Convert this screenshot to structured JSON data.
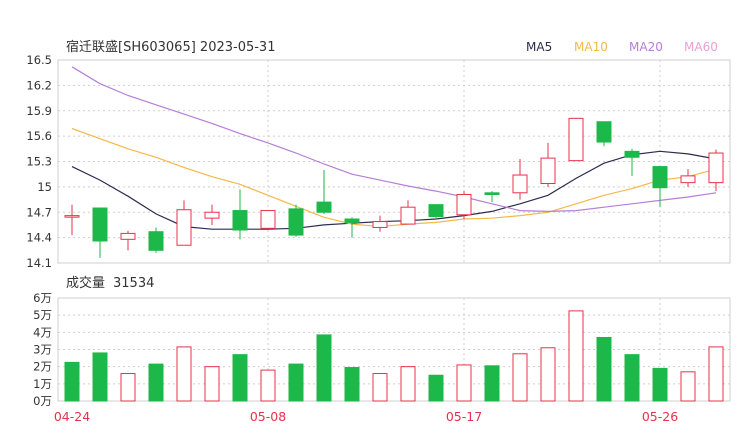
{
  "header": {
    "title": "宿迁联盛[SH603065] 2023-05-31",
    "legend": [
      {
        "label": "MA5",
        "color": "#2b2d50"
      },
      {
        "label": "MA10",
        "color": "#f5b94a"
      },
      {
        "label": "MA20",
        "color": "#b57fd6"
      },
      {
        "label": "MA60",
        "color": "#e9a0d8"
      }
    ]
  },
  "volume_header": {
    "label": "成交量",
    "value": "31534"
  },
  "colors": {
    "up": "#e8314b",
    "down": "#1db84a",
    "grid": "#cfcfcf",
    "axis_text": "#333333",
    "date_text": "#e8314b"
  },
  "chart_data": [
    {
      "type": "candlestick",
      "title": "",
      "y_ticks": [
        "16.5",
        "16.2",
        "15.9",
        "15.6",
        "15.3",
        "15",
        "14.7",
        "14.4",
        "14.1"
      ],
      "ylim": [
        14.1,
        16.5
      ],
      "grid": true,
      "x_date_labels": [
        {
          "index": 0,
          "label": "04-24"
        },
        {
          "index": 7,
          "label": "05-08"
        },
        {
          "index": 14,
          "label": "05-17"
        },
        {
          "index": 21,
          "label": "05-26"
        }
      ],
      "candles": [
        {
          "open": 14.66,
          "close": 14.66,
          "high": 14.79,
          "low": 14.43
        },
        {
          "open": 14.75,
          "close": 14.36,
          "high": 14.75,
          "low": 14.16
        },
        {
          "open": 14.38,
          "close": 14.45,
          "high": 14.48,
          "low": 14.25
        },
        {
          "open": 14.47,
          "close": 14.25,
          "high": 14.52,
          "low": 14.22
        },
        {
          "open": 14.31,
          "close": 14.73,
          "high": 14.84,
          "low": 14.31
        },
        {
          "open": 14.63,
          "close": 14.7,
          "high": 14.79,
          "low": 14.55
        },
        {
          "open": 14.72,
          "close": 14.49,
          "high": 14.97,
          "low": 14.38
        },
        {
          "open": 14.51,
          "close": 14.72,
          "high": 14.72,
          "low": 14.51
        },
        {
          "open": 14.74,
          "close": 14.43,
          "high": 14.79,
          "low": 14.41
        },
        {
          "open": 14.82,
          "close": 14.7,
          "high": 15.2,
          "low": 14.68
        },
        {
          "open": 14.62,
          "close": 14.58,
          "high": 14.64,
          "low": 14.4
        },
        {
          "open": 14.52,
          "close": 14.59,
          "high": 14.66,
          "low": 14.47
        },
        {
          "open": 14.56,
          "close": 14.76,
          "high": 14.84,
          "low": 14.56
        },
        {
          "open": 14.79,
          "close": 14.65,
          "high": 14.79,
          "low": 14.62
        },
        {
          "open": 14.67,
          "close": 14.91,
          "high": 14.95,
          "low": 14.62
        },
        {
          "open": 14.93,
          "close": 14.91,
          "high": 14.95,
          "low": 14.82
        },
        {
          "open": 14.93,
          "close": 15.14,
          "high": 15.33,
          "low": 14.85
        },
        {
          "open": 15.04,
          "close": 15.34,
          "high": 15.52,
          "low": 15.0
        },
        {
          "open": 15.31,
          "close": 15.81,
          "high": 15.81,
          "low": 15.31
        },
        {
          "open": 15.77,
          "close": 15.53,
          "high": 15.77,
          "low": 15.48
        },
        {
          "open": 15.42,
          "close": 15.35,
          "high": 15.45,
          "low": 15.13
        },
        {
          "open": 15.24,
          "close": 14.99,
          "high": 15.24,
          "low": 14.76
        },
        {
          "open": 15.05,
          "close": 15.13,
          "high": 15.21,
          "low": 15.0
        },
        {
          "open": 15.05,
          "close": 15.4,
          "high": 15.44,
          "low": 14.95
        }
      ],
      "series": [
        {
          "name": "MA5",
          "color": "#2b2d50",
          "values": [
            15.24,
            15.08,
            14.89,
            14.68,
            14.53,
            14.5,
            14.5,
            14.5,
            14.51,
            14.55,
            14.57,
            14.59,
            14.6,
            14.62,
            14.66,
            14.71,
            14.8,
            14.9,
            15.1,
            15.28,
            15.38,
            15.42,
            15.39,
            15.33
          ]
        },
        {
          "name": "MA10",
          "color": "#f5b94a",
          "values": [
            15.69,
            15.57,
            15.45,
            15.35,
            15.23,
            15.12,
            15.03,
            14.9,
            14.77,
            14.64,
            14.56,
            14.53,
            14.56,
            14.58,
            14.62,
            14.63,
            14.66,
            14.7,
            14.8,
            14.9,
            14.98,
            15.08,
            15.12,
            15.21
          ]
        },
        {
          "name": "MA20",
          "color": "#b57fd6",
          "values": [
            16.42,
            16.22,
            16.08,
            15.97,
            15.86,
            15.75,
            15.63,
            15.52,
            15.4,
            15.27,
            15.15,
            15.08,
            15.01,
            14.95,
            14.88,
            14.8,
            14.72,
            14.71,
            14.72,
            14.76,
            14.8,
            14.84,
            14.88,
            14.93
          ]
        },
        {
          "name": "MA60",
          "color": "#e9a0d8",
          "values": []
        }
      ]
    },
    {
      "type": "bar",
      "title": "",
      "y_ticks": [
        "6万",
        "5万",
        "4万",
        "3万",
        "2万",
        "1万",
        "0万"
      ],
      "ylim": [
        0,
        60000
      ],
      "grid": true,
      "values": [
        22500,
        28000,
        16000,
        21500,
        31500,
        20000,
        27000,
        18000,
        21500,
        38500,
        19500,
        16000,
        20000,
        15000,
        21000,
        20500,
        27500,
        31000,
        52500,
        37000,
        27000,
        19000,
        17000,
        31500
      ],
      "directions": [
        "down",
        "down",
        "up",
        "down",
        "up",
        "up",
        "down",
        "up",
        "down",
        "down",
        "down",
        "up",
        "up",
        "down",
        "up",
        "down",
        "up",
        "up",
        "up",
        "down",
        "down",
        "down",
        "up",
        "up"
      ]
    }
  ]
}
